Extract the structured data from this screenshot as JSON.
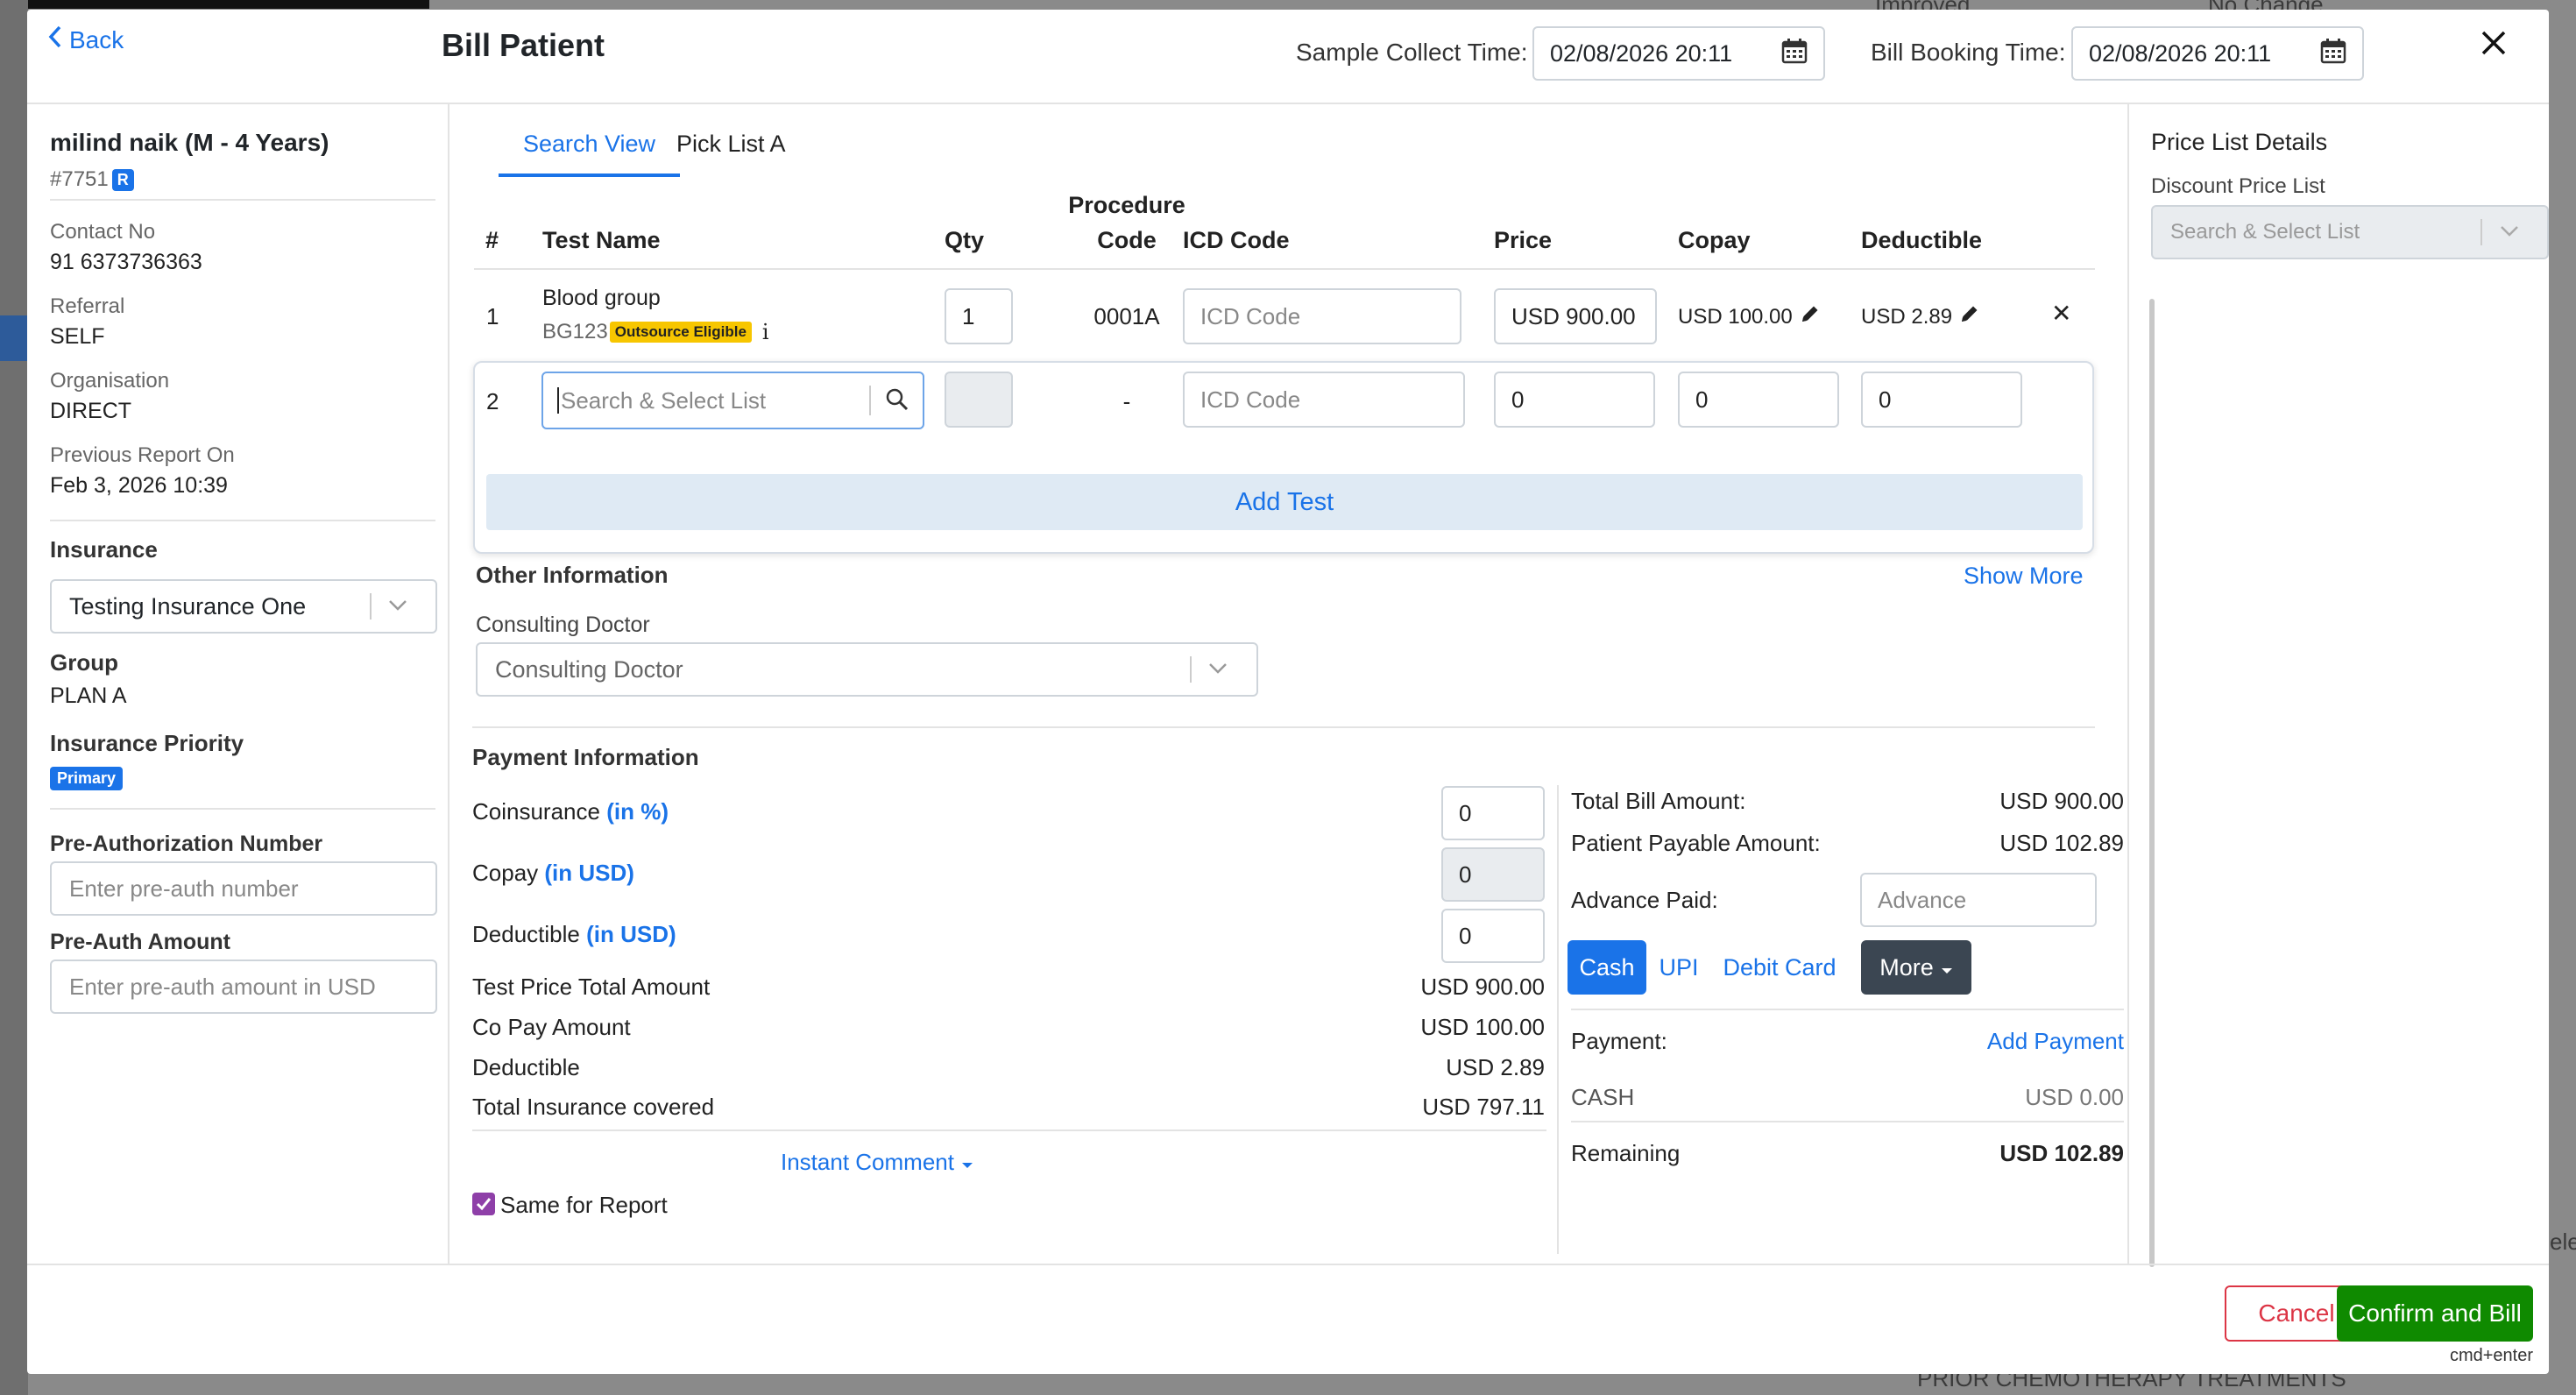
{
  "background": {
    "right_texts": [
      "Improved",
      "No Change",
      "ele",
      "PRIOR CHEMOTHERAPY TREATMENTS"
    ]
  },
  "header": {
    "back_label": "Back",
    "title": "Bill Patient",
    "sample_collect_label": "Sample Collect Time:",
    "sample_collect_value": "02/08/2026 20:11",
    "bill_booking_label": "Bill Booking Time:",
    "bill_booking_value": "02/08/2026 20:11",
    "close_icon": "close-icon"
  },
  "patient": {
    "name": "milind naik (M - 4 Years)",
    "id": "#7751",
    "badge": "R",
    "contact_label": "Contact No",
    "contact_value": "91 6373736363",
    "referral_label": "Referral",
    "referral_value": "SELF",
    "organisation_label": "Organisation",
    "organisation_value": "DIRECT",
    "previous_report_label": "Previous Report On",
    "previous_report_value": "Feb 3, 2026 10:39"
  },
  "insurance": {
    "heading": "Insurance",
    "selected": "Testing Insurance One",
    "group_label": "Group",
    "group_value": "PLAN A",
    "priority_label": "Insurance Priority",
    "priority_badge": "Primary",
    "preauth_number_label": "Pre-Authorization Number",
    "preauth_number_placeholder": "Enter pre-auth number",
    "preauth_amount_label": "Pre-Auth Amount",
    "preauth_amount_placeholder": "Enter pre-auth amount in USD"
  },
  "tabs": [
    "Search View",
    "Pick List A"
  ],
  "table": {
    "headers": {
      "num": "#",
      "test_name": "Test Name",
      "qty": "Qty",
      "procedure_code_1": "Procedure",
      "procedure_code_2": "Code",
      "icd_code": "ICD Code",
      "price": "Price",
      "copay": "Copay",
      "deductible": "Deductible"
    },
    "rows": [
      {
        "num": "1",
        "test_name": "Blood group",
        "test_code": "BG123",
        "tag": "Outsource Eligible",
        "info": "i",
        "qty": "1",
        "procedure_code": "0001A",
        "icd_placeholder": "ICD Code",
        "price": "USD 900.00",
        "copay": "USD 100.00",
        "deductible": "USD 2.89",
        "remove": "✕"
      },
      {
        "num": "2",
        "search_placeholder": "Search & Select List",
        "procedure_code": "-",
        "icd_placeholder": "ICD Code",
        "price": "0",
        "copay": "0",
        "deductible": "0"
      }
    ],
    "add_test_label": "Add Test"
  },
  "other_info": {
    "heading": "Other Information",
    "show_more": "Show More",
    "consulting_label": "Consulting Doctor",
    "consulting_placeholder": "Consulting Doctor"
  },
  "payment": {
    "heading": "Payment Information",
    "coinsurance_label": "Coinsurance",
    "coinsurance_unit": "(in %)",
    "coinsurance_value": "0",
    "copay_label": "Copay",
    "copay_unit": "(in USD)",
    "copay_value": "0",
    "deductible_label": "Deductible",
    "deductible_unit": "(in USD)",
    "deductible_value": "0",
    "summary": [
      {
        "label": "Test Price Total Amount",
        "value": "USD 900.00"
      },
      {
        "label": "Co Pay Amount",
        "value": "USD 100.00"
      },
      {
        "label": "Deductible",
        "value": "USD 2.89"
      },
      {
        "label": "Total Insurance covered",
        "value": "USD 797.11"
      }
    ],
    "instant_comment": "Instant Comment",
    "same_for_report": "Same for Report"
  },
  "totals": {
    "total_bill_label": "Total Bill Amount:",
    "total_bill_value": "USD 900.00",
    "patient_payable_label": "Patient Payable Amount:",
    "patient_payable_value": "USD 102.89",
    "advance_paid_label": "Advance Paid:",
    "advance_placeholder": "Advance",
    "methods": [
      "Cash",
      "UPI",
      "Debit Card"
    ],
    "more_label": "More",
    "payment_label": "Payment:",
    "add_payment": "Add Payment",
    "cash_label": "CASH",
    "cash_value": "USD 0.00",
    "remaining_label": "Remaining",
    "remaining_value": "USD 102.89"
  },
  "price_list": {
    "heading": "Price List Details",
    "discount_label": "Discount Price List",
    "discount_placeholder": "Search & Select List"
  },
  "footer": {
    "cancel": "Cancel",
    "confirm": "Confirm and Bill",
    "shortcut": "cmd+enter"
  },
  "colors": {
    "accent": "#1a73e8",
    "confirm": "#0f8a00",
    "cancel": "#dc3545",
    "outsource_tag": "#f7c600",
    "more_button": "#3b4652"
  }
}
